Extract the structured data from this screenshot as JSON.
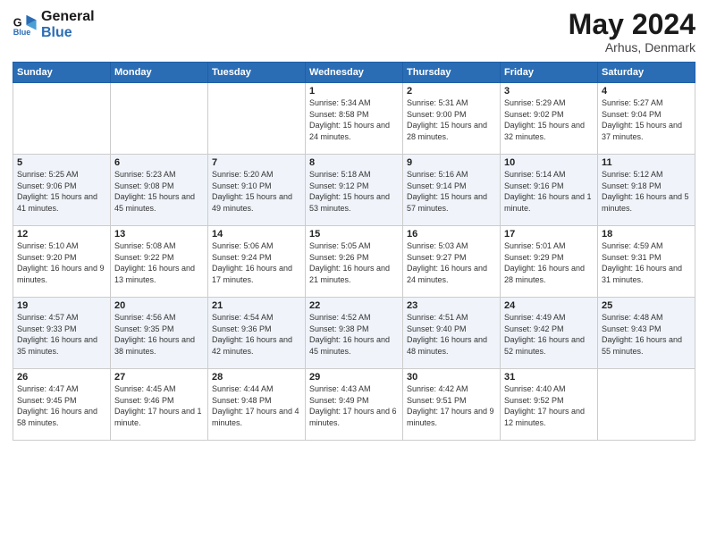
{
  "logo": {
    "line1": "General",
    "line2": "Blue"
  },
  "title": "May 2024",
  "subtitle": "Arhus, Denmark",
  "header_days": [
    "Sunday",
    "Monday",
    "Tuesday",
    "Wednesday",
    "Thursday",
    "Friday",
    "Saturday"
  ],
  "weeks": [
    [
      {
        "day": "",
        "info": ""
      },
      {
        "day": "",
        "info": ""
      },
      {
        "day": "",
        "info": ""
      },
      {
        "day": "1",
        "info": "Sunrise: 5:34 AM\nSunset: 8:58 PM\nDaylight: 15 hours\nand 24 minutes."
      },
      {
        "day": "2",
        "info": "Sunrise: 5:31 AM\nSunset: 9:00 PM\nDaylight: 15 hours\nand 28 minutes."
      },
      {
        "day": "3",
        "info": "Sunrise: 5:29 AM\nSunset: 9:02 PM\nDaylight: 15 hours\nand 32 minutes."
      },
      {
        "day": "4",
        "info": "Sunrise: 5:27 AM\nSunset: 9:04 PM\nDaylight: 15 hours\nand 37 minutes."
      }
    ],
    [
      {
        "day": "5",
        "info": "Sunrise: 5:25 AM\nSunset: 9:06 PM\nDaylight: 15 hours\nand 41 minutes."
      },
      {
        "day": "6",
        "info": "Sunrise: 5:23 AM\nSunset: 9:08 PM\nDaylight: 15 hours\nand 45 minutes."
      },
      {
        "day": "7",
        "info": "Sunrise: 5:20 AM\nSunset: 9:10 PM\nDaylight: 15 hours\nand 49 minutes."
      },
      {
        "day": "8",
        "info": "Sunrise: 5:18 AM\nSunset: 9:12 PM\nDaylight: 15 hours\nand 53 minutes."
      },
      {
        "day": "9",
        "info": "Sunrise: 5:16 AM\nSunset: 9:14 PM\nDaylight: 15 hours\nand 57 minutes."
      },
      {
        "day": "10",
        "info": "Sunrise: 5:14 AM\nSunset: 9:16 PM\nDaylight: 16 hours\nand 1 minute."
      },
      {
        "day": "11",
        "info": "Sunrise: 5:12 AM\nSunset: 9:18 PM\nDaylight: 16 hours\nand 5 minutes."
      }
    ],
    [
      {
        "day": "12",
        "info": "Sunrise: 5:10 AM\nSunset: 9:20 PM\nDaylight: 16 hours\nand 9 minutes."
      },
      {
        "day": "13",
        "info": "Sunrise: 5:08 AM\nSunset: 9:22 PM\nDaylight: 16 hours\nand 13 minutes."
      },
      {
        "day": "14",
        "info": "Sunrise: 5:06 AM\nSunset: 9:24 PM\nDaylight: 16 hours\nand 17 minutes."
      },
      {
        "day": "15",
        "info": "Sunrise: 5:05 AM\nSunset: 9:26 PM\nDaylight: 16 hours\nand 21 minutes."
      },
      {
        "day": "16",
        "info": "Sunrise: 5:03 AM\nSunset: 9:27 PM\nDaylight: 16 hours\nand 24 minutes."
      },
      {
        "day": "17",
        "info": "Sunrise: 5:01 AM\nSunset: 9:29 PM\nDaylight: 16 hours\nand 28 minutes."
      },
      {
        "day": "18",
        "info": "Sunrise: 4:59 AM\nSunset: 9:31 PM\nDaylight: 16 hours\nand 31 minutes."
      }
    ],
    [
      {
        "day": "19",
        "info": "Sunrise: 4:57 AM\nSunset: 9:33 PM\nDaylight: 16 hours\nand 35 minutes."
      },
      {
        "day": "20",
        "info": "Sunrise: 4:56 AM\nSunset: 9:35 PM\nDaylight: 16 hours\nand 38 minutes."
      },
      {
        "day": "21",
        "info": "Sunrise: 4:54 AM\nSunset: 9:36 PM\nDaylight: 16 hours\nand 42 minutes."
      },
      {
        "day": "22",
        "info": "Sunrise: 4:52 AM\nSunset: 9:38 PM\nDaylight: 16 hours\nand 45 minutes."
      },
      {
        "day": "23",
        "info": "Sunrise: 4:51 AM\nSunset: 9:40 PM\nDaylight: 16 hours\nand 48 minutes."
      },
      {
        "day": "24",
        "info": "Sunrise: 4:49 AM\nSunset: 9:42 PM\nDaylight: 16 hours\nand 52 minutes."
      },
      {
        "day": "25",
        "info": "Sunrise: 4:48 AM\nSunset: 9:43 PM\nDaylight: 16 hours\nand 55 minutes."
      }
    ],
    [
      {
        "day": "26",
        "info": "Sunrise: 4:47 AM\nSunset: 9:45 PM\nDaylight: 16 hours\nand 58 minutes."
      },
      {
        "day": "27",
        "info": "Sunrise: 4:45 AM\nSunset: 9:46 PM\nDaylight: 17 hours\nand 1 minute."
      },
      {
        "day": "28",
        "info": "Sunrise: 4:44 AM\nSunset: 9:48 PM\nDaylight: 17 hours\nand 4 minutes."
      },
      {
        "day": "29",
        "info": "Sunrise: 4:43 AM\nSunset: 9:49 PM\nDaylight: 17 hours\nand 6 minutes."
      },
      {
        "day": "30",
        "info": "Sunrise: 4:42 AM\nSunset: 9:51 PM\nDaylight: 17 hours\nand 9 minutes."
      },
      {
        "day": "31",
        "info": "Sunrise: 4:40 AM\nSunset: 9:52 PM\nDaylight: 17 hours\nand 12 minutes."
      },
      {
        "day": "",
        "info": ""
      }
    ]
  ]
}
